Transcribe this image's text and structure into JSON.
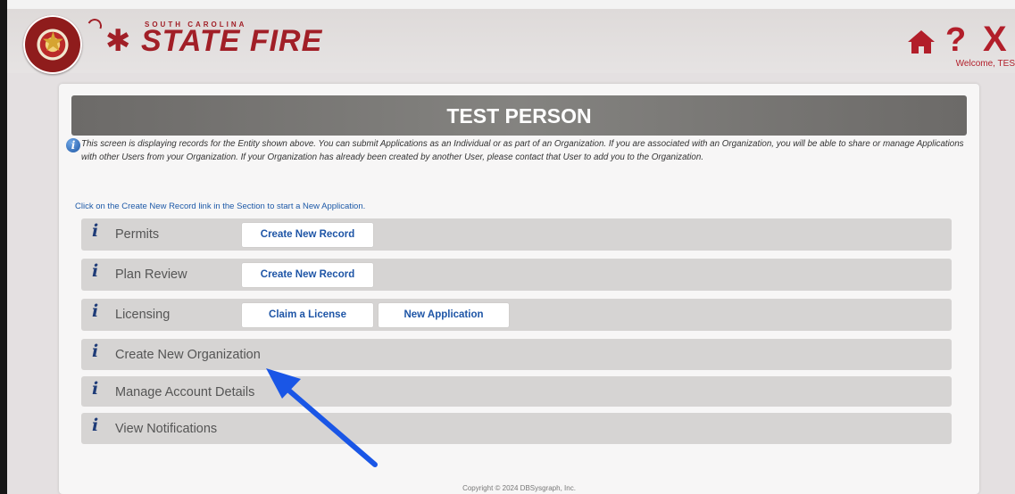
{
  "header": {
    "brand_small": "SOUTH CAROLINA",
    "brand_big": "STATE FIRE",
    "welcome": "Welcome, TES"
  },
  "icons": {
    "home": "home-icon",
    "help": "help-icon",
    "close": "close-icon",
    "help_glyph": "?",
    "close_glyph": "X"
  },
  "colors": {
    "brand": "#a11f27",
    "link": "#1e55a6",
    "name_bar": "#7a7876"
  },
  "entity": {
    "name": "TEST PERSON",
    "info_text": "This screen is displaying records for the Entity shown above. You can submit Applications as an Individual or as part of an Organization. If you are associated with an Organization, you will be able to share or manage Applications with other Users from your Organization. If your Organization has already been created by another User, please contact that User to add you to the Organization."
  },
  "instruction": "Click on the Create New Record link in the Section to start a New Application.",
  "sections": [
    {
      "label": "Permits",
      "buttons": [
        "Create New Record"
      ]
    },
    {
      "label": "Plan Review",
      "buttons": [
        "Create New Record"
      ]
    },
    {
      "label": "Licensing",
      "buttons": [
        "Claim a License",
        "New Application"
      ]
    },
    {
      "label": "Create New Organization",
      "buttons": []
    },
    {
      "label": "Manage Account Details",
      "buttons": []
    },
    {
      "label": "View Notifications",
      "buttons": []
    }
  ],
  "info_glyph": "i",
  "footer": "Copyright © 2024 DBSysgraph, Inc."
}
